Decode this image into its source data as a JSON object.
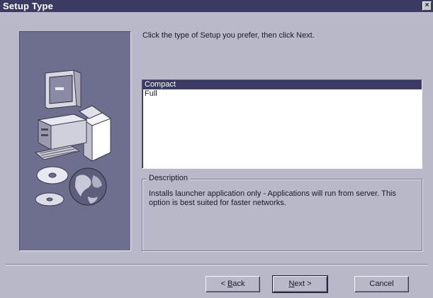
{
  "window": {
    "title": "Setup Type",
    "close_glyph": "×"
  },
  "instruction": "Click the type of Setup you prefer, then click Next.",
  "setup_list": {
    "items": [
      {
        "label": "Compact",
        "selected": true
      },
      {
        "label": "Full",
        "selected": false
      }
    ]
  },
  "description": {
    "legend": "Description",
    "text": "Installs launcher application only - Applications will run from server.  This option is best suited for faster networks."
  },
  "buttons": {
    "back": {
      "prefix": "< ",
      "accel": "B",
      "rest": "ack"
    },
    "next": {
      "accel": "N",
      "rest": "ext >"
    },
    "cancel": "Cancel"
  },
  "side_panel": {
    "art": "computer-and-cd-illustration"
  },
  "colors": {
    "titlebar": "#3a3a62",
    "window_bg": "#b8b8c8",
    "panel_bg": "#6e6e8e",
    "selection": "#3a3a62"
  }
}
